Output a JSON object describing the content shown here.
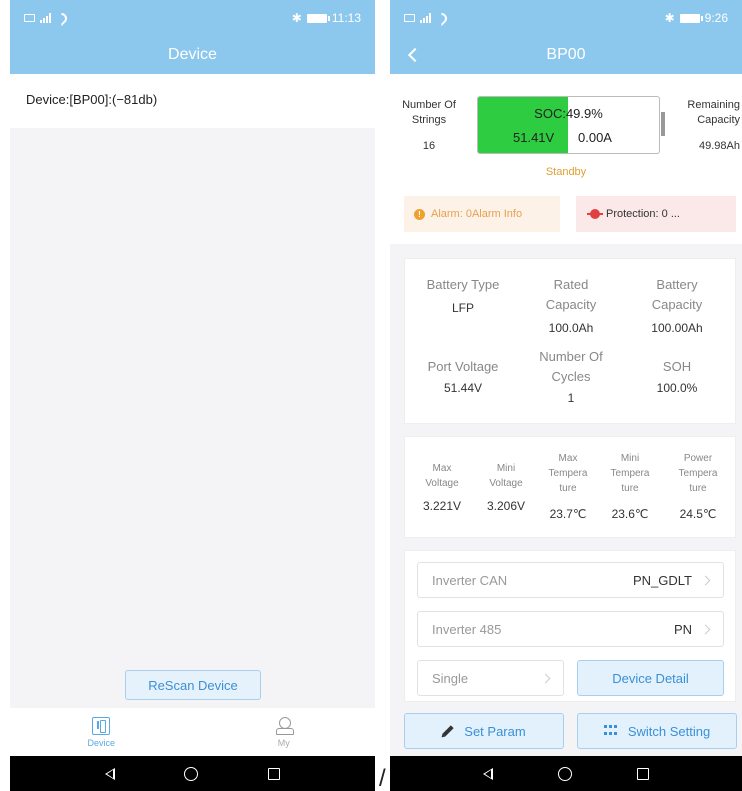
{
  "left": {
    "status": {
      "time": "11:13"
    },
    "title": "Device",
    "device_entry": "Device:[BP00]:(−81db)",
    "rescan_label": "ReScan Device",
    "tabs": [
      {
        "label": "Device",
        "active": true,
        "icon": "device-icon"
      },
      {
        "label": "My",
        "active": false,
        "icon": "user-icon"
      }
    ]
  },
  "right": {
    "status": {
      "time": "9:26"
    },
    "title": "BP00",
    "summary": {
      "strings_label": "Number Of Strings",
      "strings_value": "16",
      "remaining_label": "Remaining Capacity",
      "remaining_value": "49.98Ah",
      "soc": "SOC:49.9%",
      "soc_percent": 49.9,
      "voltage": "51.41V",
      "current": "0.00A",
      "state": "Standby"
    },
    "alarm": "Alarm: 0Alarm Info",
    "protection": "Protection: 0 ...",
    "info": {
      "battery_type_label": "Battery Type",
      "battery_type": "LFP",
      "rated_capacity_label": "Rated Capacity",
      "rated_capacity": "100.0Ah",
      "battery_capacity_label": "Battery Capacity",
      "battery_capacity": "100.00Ah",
      "port_voltage_label": "Port Voltage",
      "port_voltage": "51.44V",
      "cycles_label": "Number Of Cycles",
      "cycles": "1",
      "soh_label": "SOH",
      "soh": "100.0%"
    },
    "cells": {
      "max_voltage_label": "Max Voltage",
      "max_voltage": "3.221V",
      "mini_voltage_label": "Mini Voltage",
      "mini_voltage": "3.206V",
      "max_temp_label": "Max Tempera ture",
      "max_temp": "23.7℃",
      "mini_temp_label": "Mini Tempera ture",
      "mini_temp": "23.6℃",
      "power_temp_label": "Power Tempera ture",
      "power_temp": "24.5℃"
    },
    "settings": {
      "can_label": "Inverter CAN",
      "can_value": "PN_GDLT",
      "rs485_label": "Inverter 485",
      "rs485_value": "PN",
      "mode_label": "Single",
      "detail_label": "Device Detail"
    },
    "actions": {
      "set_param": "Set Param",
      "switch_setting": "Switch Setting"
    }
  },
  "separator": "/"
}
